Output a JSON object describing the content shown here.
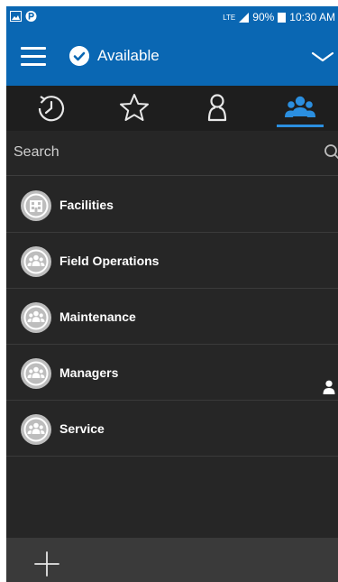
{
  "status_bar": {
    "network": "LTE",
    "battery": "90%",
    "time": "10:30 AM",
    "icons": [
      "image-icon",
      "p-badge-icon",
      "signal-icon",
      "battery-icon"
    ]
  },
  "header": {
    "status_label": "Available",
    "icons": [
      "menu-icon",
      "check-circle-icon",
      "chevron-down-icon"
    ]
  },
  "tabs": [
    {
      "name": "recent",
      "icon": "history-icon",
      "active": false
    },
    {
      "name": "favorites",
      "icon": "star-icon",
      "active": false
    },
    {
      "name": "contacts",
      "icon": "person-icon",
      "active": false
    },
    {
      "name": "groups",
      "icon": "group-icon",
      "active": true
    }
  ],
  "search": {
    "placeholder": "Search",
    "value": ""
  },
  "groups": [
    {
      "label": "Facilities",
      "icon": "facility-group-icon",
      "indicator": false
    },
    {
      "label": "Field Operations",
      "icon": "group-icon",
      "indicator": false
    },
    {
      "label": "Maintenance",
      "icon": "group-icon",
      "indicator": false
    },
    {
      "label": "Managers",
      "icon": "group-icon",
      "indicator": true
    },
    {
      "label": "Service",
      "icon": "group-icon",
      "indicator": false
    }
  ],
  "bottom_bar": {
    "icon": "add-icon"
  },
  "colors": {
    "accent": "#0a67b3",
    "background": "#262626",
    "active_tab": "#2b8fe0",
    "footer": "#3a3a3a"
  }
}
